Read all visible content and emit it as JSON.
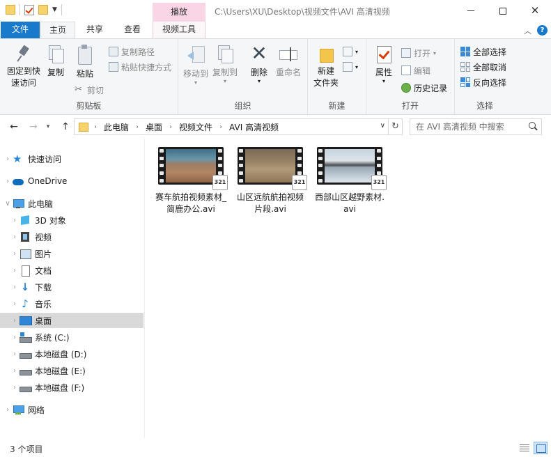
{
  "window": {
    "title": "C:\\Users\\XU\\Desktop\\视频文件\\AVI 高清视频",
    "contextual_header": "播放"
  },
  "tabs": {
    "file": "文件",
    "home": "主页",
    "share": "共享",
    "view": "查看",
    "video_tools": "视频工具"
  },
  "ribbon": {
    "clipboard": {
      "label": "剪贴板",
      "pin_quick_access": "固定到快速访问",
      "copy": "复制",
      "paste": "粘贴",
      "copy_path": "复制路径",
      "paste_shortcut": "粘贴快捷方式",
      "cut": "剪切"
    },
    "organize": {
      "label": "组织",
      "move_to": "移动到",
      "copy_to": "复制到",
      "delete": "删除",
      "rename": "重命名"
    },
    "new": {
      "label": "新建",
      "new_folder_line1": "新建",
      "new_folder_line2": "文件夹"
    },
    "open": {
      "label": "打开",
      "properties": "属性",
      "open": "打开",
      "edit": "编辑",
      "history": "历史记录"
    },
    "select": {
      "label": "选择",
      "select_all": "全部选择",
      "select_none": "全部取消",
      "invert": "反向选择"
    }
  },
  "address": {
    "crumbs": [
      "此电脑",
      "桌面",
      "视频文件",
      "AVI 高清视频"
    ],
    "search_placeholder": "在 AVI 高清视频 中搜索"
  },
  "nav": {
    "quick_access": "快速访问",
    "onedrive": "OneDrive",
    "this_pc": "此电脑",
    "objects_3d": "3D 对象",
    "videos": "视频",
    "pictures": "图片",
    "documents": "文档",
    "downloads": "下载",
    "music": "音乐",
    "desktop": "桌面",
    "drive_c": "系统 (C:)",
    "drive_d": "本地磁盘 (D:)",
    "drive_e": "本地磁盘 (E:)",
    "drive_f": "本地磁盘 (F:)",
    "network": "网络"
  },
  "files": [
    {
      "name": "赛车航拍视频素材_简鹿办公.avi"
    },
    {
      "name": "山区远航航拍视频片段.avi"
    },
    {
      "name": "西部山区越野素材.avi"
    }
  ],
  "badge_text": "321",
  "status": {
    "item_count": "3 个项目"
  }
}
